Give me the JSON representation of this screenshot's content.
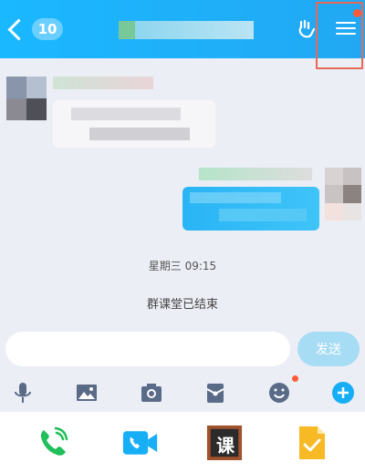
{
  "header": {
    "unread_count": "10",
    "colors": {
      "bar": "#1ab8ff",
      "notify_dot": "#ff5b3a"
    }
  },
  "chat": {
    "timestamp": "星期三 09:15",
    "system_message": "群课堂已结束"
  },
  "composer": {
    "input_value": "",
    "send_label": "发送"
  },
  "toolbar": {
    "icons": [
      "microphone-icon",
      "image-icon",
      "camera-icon",
      "red-packet-icon",
      "emoji-icon",
      "plus-icon"
    ]
  },
  "bottom_apps": {
    "icons": [
      "phone-call-icon",
      "video-call-icon",
      "classroom-icon",
      "homework-icon"
    ],
    "classroom_label": "课"
  }
}
